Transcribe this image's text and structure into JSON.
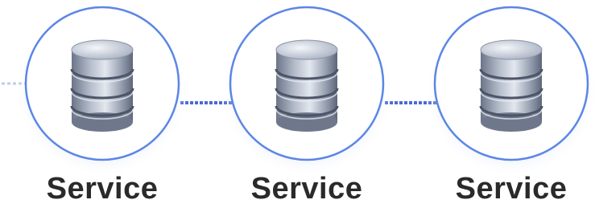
{
  "services": [
    {
      "label": "Service",
      "icon": "database-icon"
    },
    {
      "label": "Service",
      "icon": "database-icon"
    },
    {
      "label": "Service",
      "icon": "database-icon"
    }
  ],
  "colors": {
    "node_border": "#5b86e5",
    "connector": "#4a6ad4",
    "label": "#2a2a2a"
  }
}
